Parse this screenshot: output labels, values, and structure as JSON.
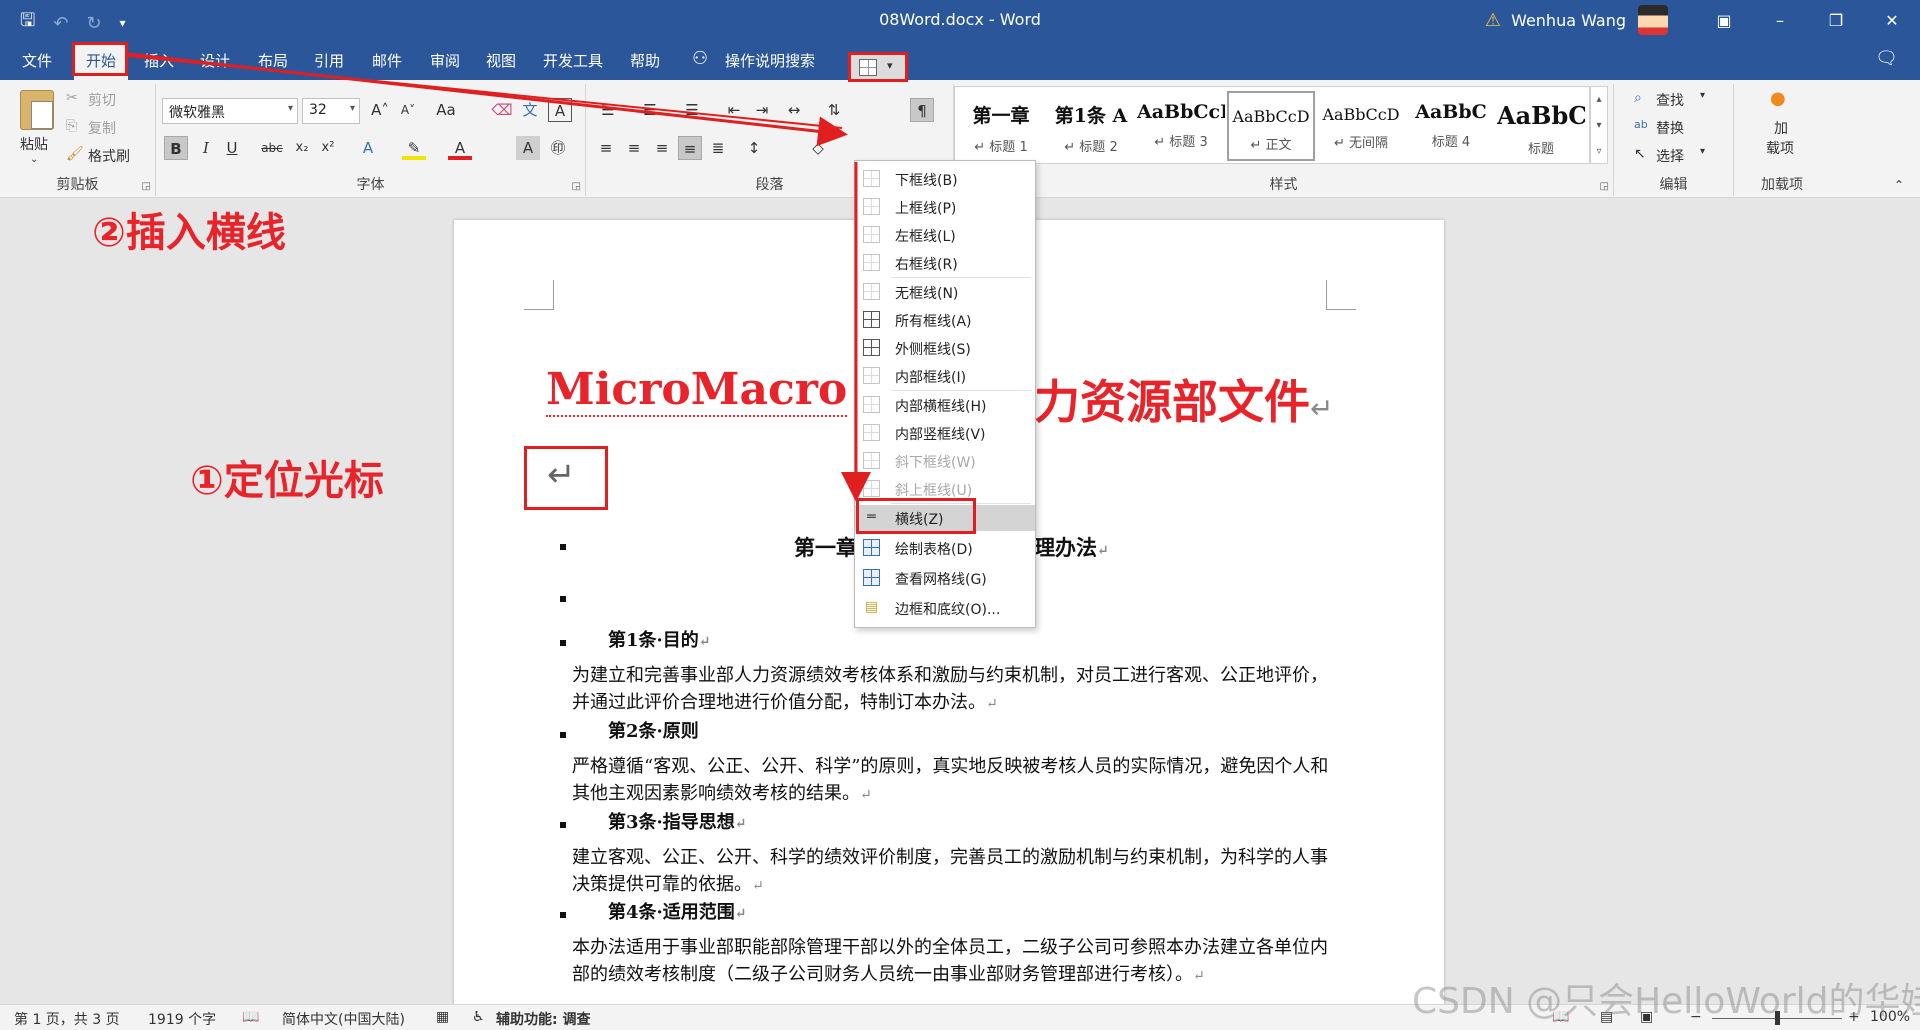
{
  "titlebar": {
    "doc_title": "08Word.docx  -  Word",
    "user": "Wenhua Wang",
    "qat": [
      "save-icon",
      "undo-icon",
      "redo-icon",
      "customize-icon"
    ]
  },
  "tabs": [
    "文件",
    "开始",
    "插入",
    "设计",
    "布局",
    "引用",
    "邮件",
    "审阅",
    "视图",
    "开发工具",
    "帮助"
  ],
  "tell_me": "操作说明搜索",
  "clipboard": {
    "paste": "粘贴",
    "cut": "剪切",
    "copy": "复制",
    "format_painter": "格式刷",
    "label": "剪贴板"
  },
  "font": {
    "name": "微软雅黑",
    "size": "32",
    "label": "字体",
    "change_case": "Aa"
  },
  "paragraph": {
    "label": "段落"
  },
  "styles": {
    "label": "样式",
    "items": [
      {
        "sample": "第一章",
        "name": "↵ 标题 1"
      },
      {
        "sample": "第1条 A",
        "name": "↵ 标题 2"
      },
      {
        "sample": "AaBbCcI",
        "name": "↵ 标题 3"
      },
      {
        "sample": "AaBbCcD",
        "name": "↵ 正文"
      },
      {
        "sample": "AaBbCcD",
        "name": "↵ 无间隔"
      },
      {
        "sample": "AaBbC",
        "name": "标题 4"
      },
      {
        "sample": "AaBbC",
        "name": "标题"
      }
    ]
  },
  "editing": {
    "find": "查找",
    "replace": "替换",
    "select": "选择",
    "label": "编辑"
  },
  "addins": {
    "line1": "加",
    "line2": "载项",
    "label": "加载项"
  },
  "annotations": {
    "step1": "①定位光标",
    "step2": "②插入横线"
  },
  "document": {
    "heading_a": "MicroMacro",
    "heading_b": "力资源部文件",
    "para_mark": "↵",
    "chapter_a": "第一章",
    "chapter_b": "理办法",
    "articles": [
      {
        "title": "第1条·目的",
        "body": "为建立和完善事业部人力资源绩效考核体系和激励与约束机制，对员工进行客观、公正地评价，并通过此评价合理地进行价值分配，特制订本办法。"
      },
      {
        "title": "第2条·原则",
        "body": "严格遵循“客观、公正、公开、科学”的原则，真实地反映被考核人员的实际情况，避免因个人和其他主观因素影响绩效考核的结果。"
      },
      {
        "title": "第3条·指导思想",
        "body": "建立客观、公正、公开、科学的绩效评价制度，完善员工的激励机制与约束机制，为科学的人事决策提供可靠的依据。"
      },
      {
        "title": "第4条·适用范围",
        "body": "本办法适用于事业部职能部除管理干部以外的全体员工，二级子公司可参照本办法建立各单位内部的绩效考核制度（二级子公司财务人员统一由事业部财务管理部进行考核）。"
      }
    ]
  },
  "borders_menu": [
    {
      "label": "下框线(B)",
      "icon": "bottom-border-icon"
    },
    {
      "label": "上框线(P)",
      "icon": "top-border-icon"
    },
    {
      "label": "左框线(L)",
      "icon": "left-border-icon"
    },
    {
      "label": "右框线(R)",
      "icon": "right-border-icon"
    },
    {
      "label": "无框线(N)",
      "icon": "no-border-icon"
    },
    {
      "label": "所有框线(A)",
      "icon": "all-borders-icon"
    },
    {
      "label": "外侧框线(S)",
      "icon": "outside-borders-icon"
    },
    {
      "label": "内部框线(I)",
      "icon": "inside-borders-icon"
    },
    {
      "label": "内部横框线(H)",
      "icon": "inside-horizontal-border-icon"
    },
    {
      "label": "内部竖框线(V)",
      "icon": "inside-vertical-border-icon"
    },
    {
      "label": "斜下框线(W)",
      "icon": "diagonal-down-border-icon"
    },
    {
      "label": "斜上框线(U)",
      "icon": "diagonal-up-border-icon"
    },
    {
      "label": "横线(Z)",
      "icon": "horizontal-line-icon"
    },
    {
      "label": "绘制表格(D)",
      "icon": "draw-table-icon"
    },
    {
      "label": "查看网格线(G)",
      "icon": "view-gridlines-icon"
    },
    {
      "label": "边框和底纹(O)...",
      "icon": "borders-shading-icon"
    }
  ],
  "statusbar": {
    "page": "第 1 页，共 3 页",
    "words": "1919 个字",
    "language": "简体中文(中国大陆)",
    "accessibility": "辅助功能: 调查",
    "zoom": "100%",
    "zoom_level": 0.5
  },
  "watermark": "CSDN @只会HelloWorld的华娃"
}
